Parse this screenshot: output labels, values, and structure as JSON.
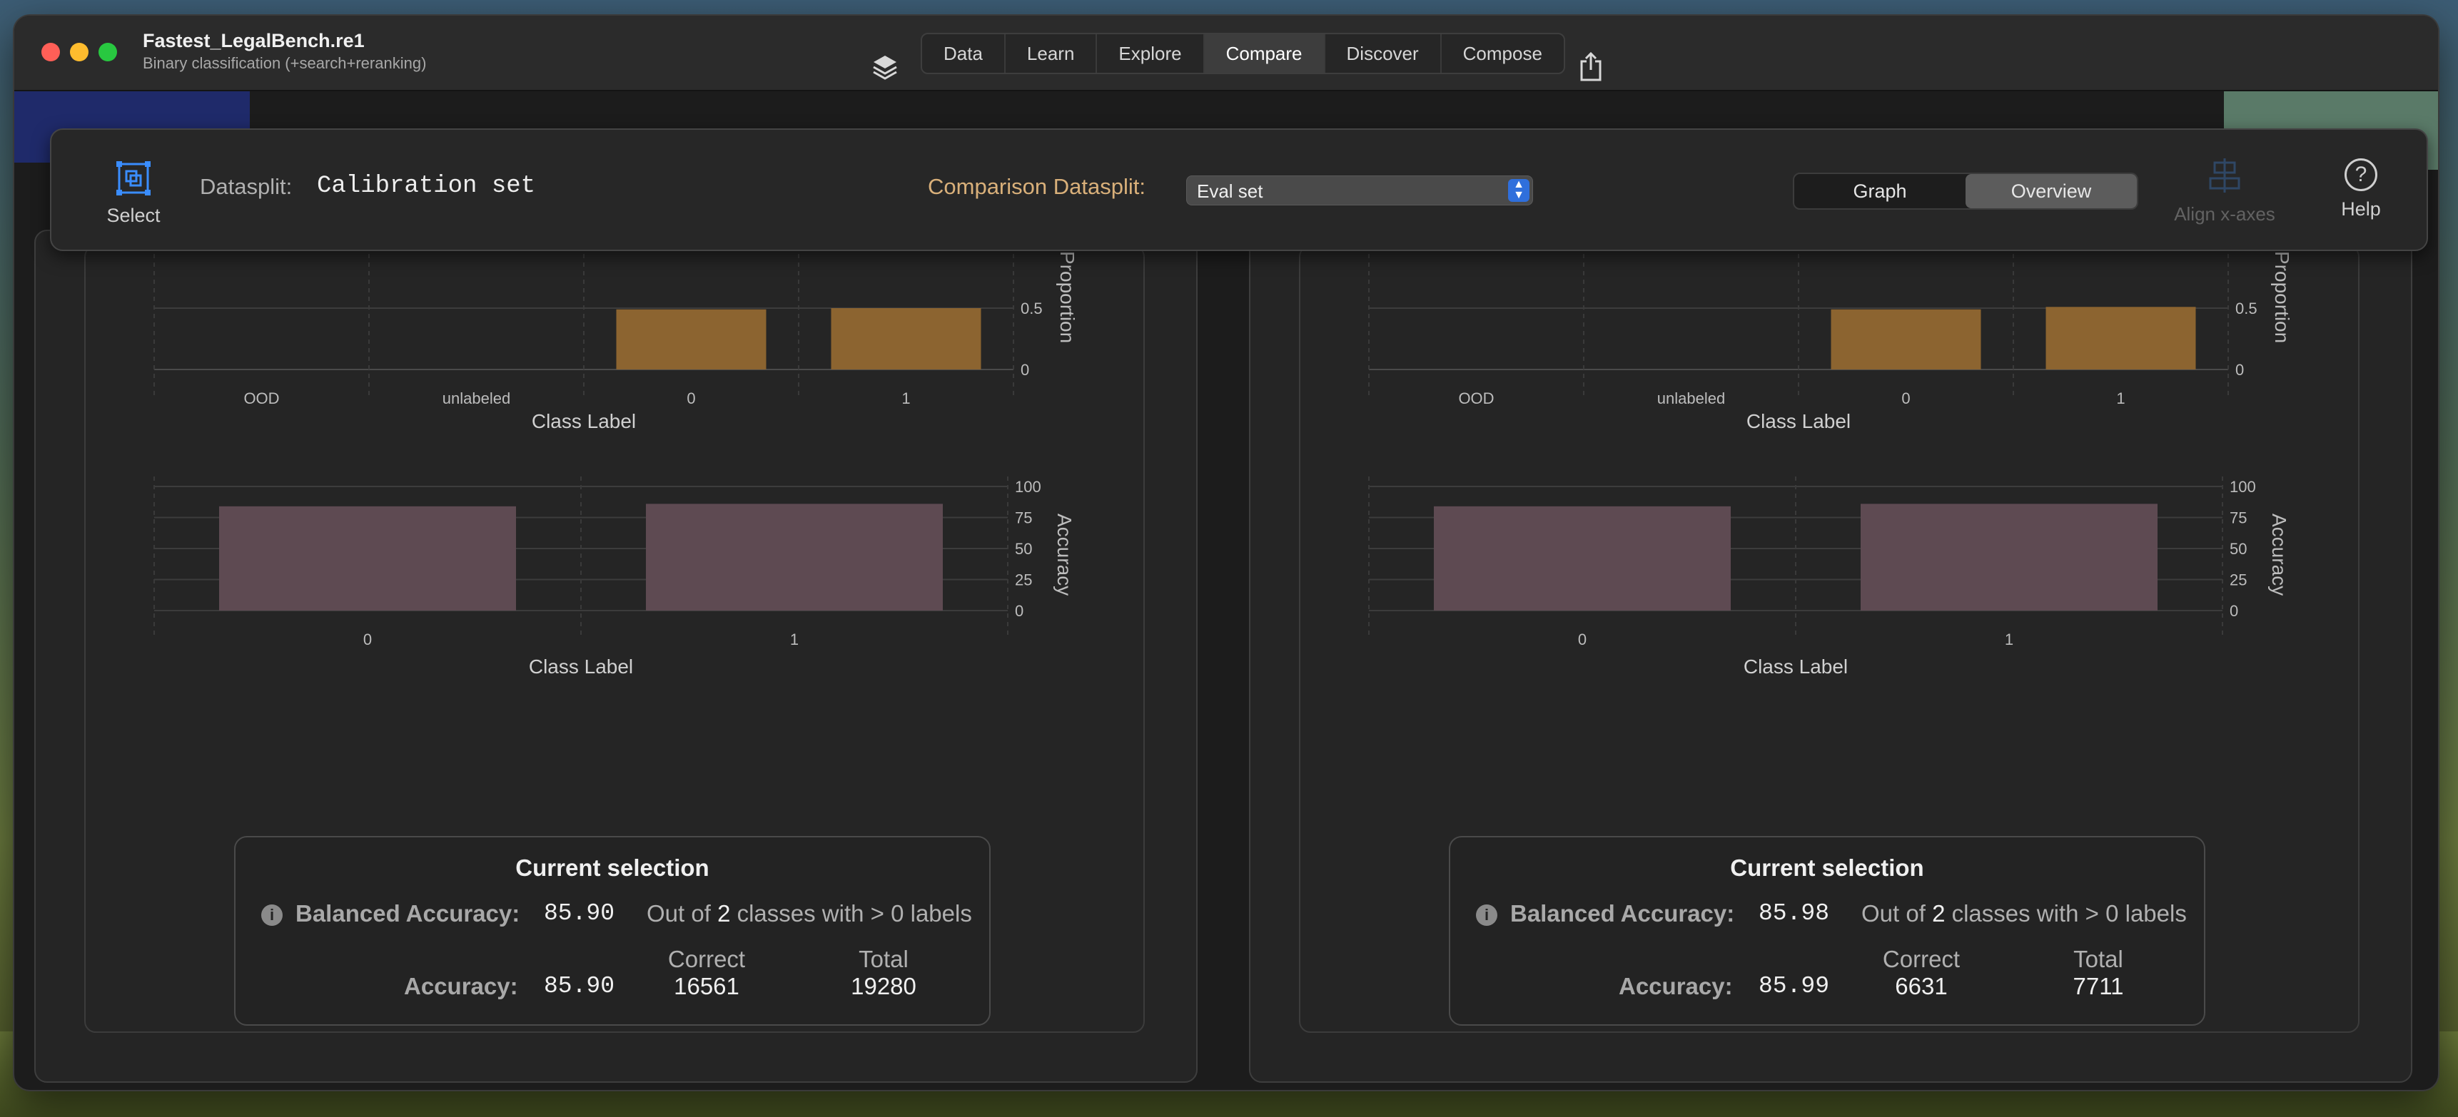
{
  "window": {
    "title": "Fastest_LegalBench.re1",
    "subtitle": "Binary classification (+search+reranking)"
  },
  "nav": {
    "tabs": [
      {
        "label": "Data"
      },
      {
        "label": "Learn"
      },
      {
        "label": "Explore"
      },
      {
        "label": "Compare",
        "active": true
      },
      {
        "label": "Discover"
      },
      {
        "label": "Compose"
      }
    ]
  },
  "toolbar": {
    "select_label": "Select",
    "datasplit_label": "Datasplit:",
    "datasplit_value": "Calibration set",
    "comparison_label": "Comparison Datasplit:",
    "comparison_value": "Eval set",
    "view_options": [
      "Graph",
      "Overview"
    ],
    "view_selected": "Overview",
    "align_label": "Align x-axes",
    "help_label": "Help"
  },
  "colors": {
    "proportion_bar": "#8c6430",
    "accuracy_bar": "#5e4a52",
    "comparison_label": "#d9b07a"
  },
  "panels": [
    {
      "proportion_chart": {
        "type": "bar",
        "categories": [
          "OOD",
          "unlabeled",
          "0",
          "1"
        ],
        "values": [
          0,
          0,
          0.49,
          0.5
        ],
        "ylabel": "Proportion",
        "xlabel": "Class Label",
        "yticks": [
          "0.5",
          "0"
        ]
      },
      "accuracy_chart": {
        "type": "bar",
        "categories": [
          "0",
          "1"
        ],
        "values": [
          84,
          86
        ],
        "ylabel": "Accuracy",
        "xlabel": "Class Label",
        "ylim": [
          0,
          100
        ],
        "yticks": [
          "100",
          "75",
          "50",
          "25",
          "0"
        ]
      },
      "selection": {
        "title": "Current selection",
        "balanced_label": "Balanced Accuracy:",
        "balanced_value": "85.90",
        "outof_pre": "Out of",
        "outof_count": "2",
        "outof_post": "classes with > 0 labels",
        "accuracy_label": "Accuracy:",
        "accuracy_value": "85.90",
        "correct_label": "Correct",
        "correct_value": "16561",
        "total_label": "Total",
        "total_value": "19280"
      }
    },
    {
      "proportion_chart": {
        "type": "bar",
        "categories": [
          "OOD",
          "unlabeled",
          "0",
          "1"
        ],
        "values": [
          0,
          0,
          0.49,
          0.51
        ],
        "ylabel": "Proportion",
        "xlabel": "Class Label",
        "yticks": [
          "0.5",
          "0"
        ]
      },
      "accuracy_chart": {
        "type": "bar",
        "categories": [
          "0",
          "1"
        ],
        "values": [
          84,
          86
        ],
        "ylabel": "Accuracy",
        "xlabel": "Class Label",
        "ylim": [
          0,
          100
        ],
        "yticks": [
          "100",
          "75",
          "50",
          "25",
          "0"
        ]
      },
      "selection": {
        "title": "Current selection",
        "balanced_label": "Balanced Accuracy:",
        "balanced_value": "85.98",
        "outof_pre": "Out of",
        "outof_count": "2",
        "outof_post": "classes with > 0 labels",
        "accuracy_label": "Accuracy:",
        "accuracy_value": "85.99",
        "correct_label": "Correct",
        "correct_value": "6631",
        "total_label": "Total",
        "total_value": "7711"
      }
    }
  ]
}
